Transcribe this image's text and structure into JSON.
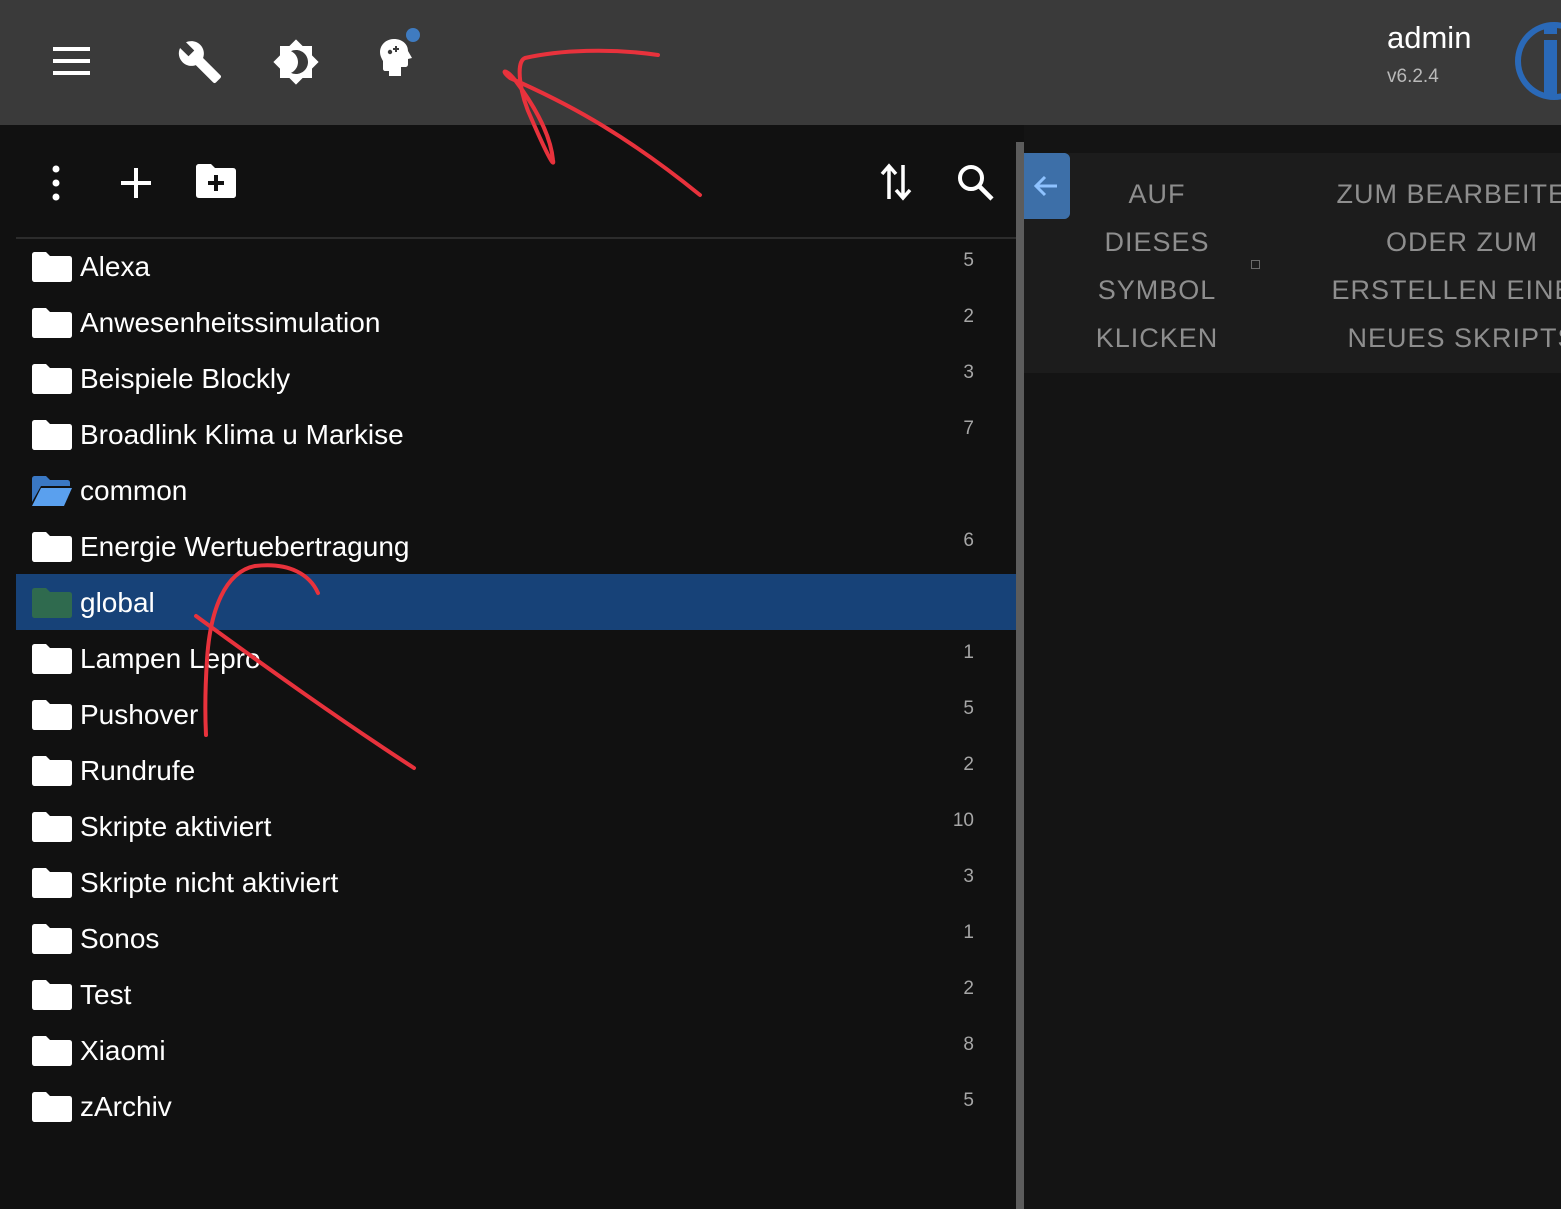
{
  "header": {
    "user": "admin",
    "version": "v6.2.4",
    "icons": [
      "menu-icon",
      "wrench-icon",
      "theme-toggle-icon",
      "expert-mode-icon",
      "iobroker-logo"
    ]
  },
  "toolbar": {
    "icons": [
      "more-vert-icon",
      "add-icon",
      "create-folder-icon",
      "sort-icon",
      "search-icon"
    ]
  },
  "folders": [
    {
      "name": "Alexa",
      "count": "5",
      "state": "closed"
    },
    {
      "name": "Anwesenheitssimulation",
      "count": "2",
      "state": "closed"
    },
    {
      "name": "Beispiele Blockly",
      "count": "3",
      "state": "closed"
    },
    {
      "name": "Broadlink Klima u Markise",
      "count": "7",
      "state": "closed"
    },
    {
      "name": "common",
      "count": "",
      "state": "open"
    },
    {
      "name": "Energie Wertuebertragung",
      "count": "6",
      "state": "closed"
    },
    {
      "name": "global",
      "count": "",
      "state": "selected"
    },
    {
      "name": "Lampen Lepro",
      "count": "1",
      "state": "closed"
    },
    {
      "name": "Pushover",
      "count": "5",
      "state": "closed"
    },
    {
      "name": "Rundrufe",
      "count": "2",
      "state": "closed"
    },
    {
      "name": "Skripte aktiviert",
      "count": "10",
      "state": "closed"
    },
    {
      "name": "Skripte nicht aktiviert",
      "count": "3",
      "state": "closed"
    },
    {
      "name": "Sonos",
      "count": "1",
      "state": "closed"
    },
    {
      "name": "Test",
      "count": "2",
      "state": "closed"
    },
    {
      "name": "Xiaomi",
      "count": "8",
      "state": "closed"
    },
    {
      "name": "zArchiv",
      "count": "5",
      "state": "closed"
    }
  ],
  "hint": {
    "left_lines": [
      "AUF",
      "DIESES",
      "SYMBOL",
      "KLICKEN"
    ],
    "right_lines": [
      "ZUM BEARBEITEN",
      "ODER ZUM",
      "ERSTELLEN EINES",
      "NEUES SKRIPTS"
    ]
  },
  "colors": {
    "topbar": "#3a3a3a",
    "panel": "#111111",
    "selected_row": "#174278",
    "open_folder": "#4a90d9",
    "global_folder": "#2f6a4e",
    "accent_dot": "#3f7bc0",
    "annotation": "#e8323c"
  }
}
